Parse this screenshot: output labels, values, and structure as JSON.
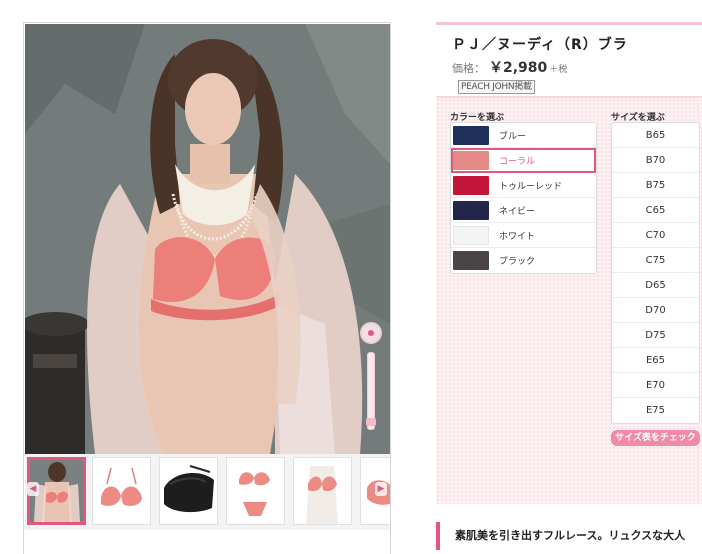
{
  "product": {
    "name": "ＰＪ／ヌーディ（R）ブラ",
    "price_label": "価格：",
    "price": "￥2,980",
    "tax_note": "＋税",
    "brand_badge": "PEACH JOHN掲載"
  },
  "viewer": {
    "main_image": "model-wearing-coral-lace-bra-photo",
    "thumbnails": [
      {
        "name": "model-photo",
        "active": true
      },
      {
        "name": "bra-front",
        "active": false
      },
      {
        "name": "bra-inside-black",
        "active": false
      },
      {
        "name": "bra-and-panty-set",
        "active": false
      },
      {
        "name": "bra-on-mannequin",
        "active": false
      },
      {
        "name": "bra-detail",
        "active": false
      }
    ]
  },
  "color_selector": {
    "heading": "カラーを選ぶ",
    "options": [
      {
        "label": "ブルー",
        "swatch": "#1e2f5a",
        "selected": false
      },
      {
        "label": "コーラル",
        "swatch": "#e48a84",
        "selected": true
      },
      {
        "label": "トゥルーレッド",
        "swatch": "#c4163a",
        "selected": false
      },
      {
        "label": "ネイビー",
        "swatch": "#23264a",
        "selected": false
      },
      {
        "label": "ホワイト",
        "swatch": "#f4f4f4",
        "selected": false
      },
      {
        "label": "ブラック",
        "swatch": "#4a4448",
        "selected": false
      }
    ]
  },
  "size_selector": {
    "heading": "サイズを選ぶ",
    "options": [
      "B65",
      "B70",
      "B75",
      "C65",
      "C70",
      "C75",
      "D65",
      "D70",
      "D75",
      "E65",
      "E70",
      "E75"
    ],
    "chart_button": "サイズ表をチェック"
  },
  "catch_copy": "素肌美を引き出すフルレース。リュクスな大人",
  "colors": {
    "accent": "#e2577f",
    "panel_bg": "#fdf1f3"
  }
}
